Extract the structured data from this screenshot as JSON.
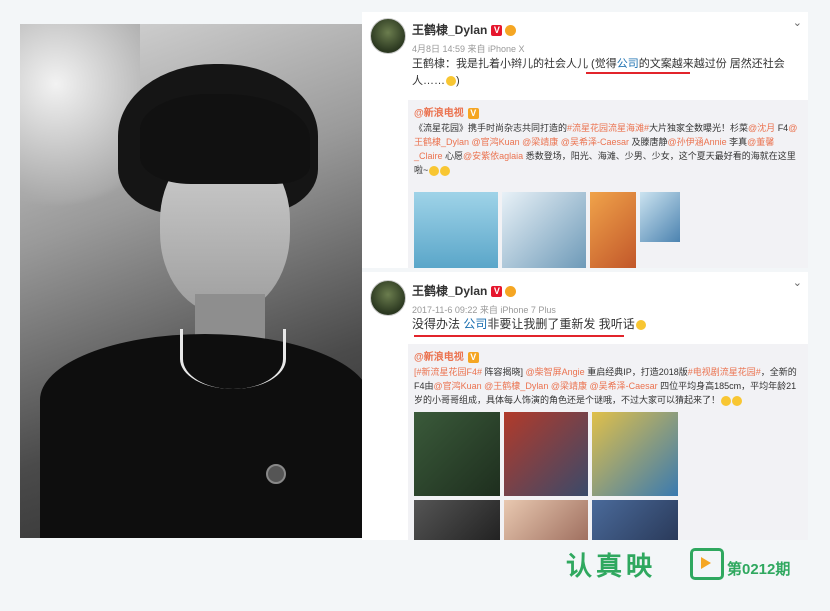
{
  "post1": {
    "username": "王鹤棣_Dylan",
    "meta": "4月8日 14:59 来自 iPhone X",
    "text_a": "王鹤棣：我是扎着小辫儿的社会人儿 (",
    "text_hl1": "觉得",
    "text_hl2": "公司",
    "text_hl3": "的文案越来越过份",
    "text_b": " 居然还社会人……",
    "repost": {
      "who": "@新浪电视",
      "body_a": "《流星花园》携手时尚杂志共同打造的",
      "tag": "#流星花园流星海滩#",
      "body_b": "大片独家全数曝光！杉菜",
      "names1": "@沈月",
      "body_c": " F4",
      "names2": "@王鹤棣_Dylan @官鸿Kuan @梁靖康 @吴希泽-Caesar",
      "body_d": " 及滕唐静",
      "names3": "@孙伊涵Annie",
      "body_e": " 李真",
      "names4": "@董馨_Claire",
      "body_f": " 心愿",
      "names5": "@安紫依aglaia",
      "body_g": " 悉数登场，阳光、海滩、少男、少女，这个夏天最好看的海就在这里啦~"
    }
  },
  "post2": {
    "username": "王鹤棣_Dylan",
    "meta": "2017-11-6 09:22 来自 iPhone 7 Plus",
    "text_a": "没得办法 ",
    "text_hl": "公司",
    "text_b": "非要让我删了重新发 我听话",
    "repost": {
      "who": "@新浪电视",
      "tag": "[#新流星花园F4#",
      "body_a": " 阵容揭晓] ",
      "names1": "@柴智屏Angie",
      "body_b": " 重启经典IP，打造2018版",
      "tag2": "#电视剧流星花园#",
      "body_c": "，全新的F4由",
      "names2": "@官鸿Kuan @王鹤棣_Dylan @梁靖康 @吴希泽-Caesar",
      "body_d": " 四位平均身高185cm，平均年龄21岁的小哥哥组成，具体每人饰演的角色还是个谜哦，不过大家可以猜起来了！"
    }
  },
  "brand": {
    "name": "认真映",
    "issue": "第0212期"
  },
  "colors": {
    "brand_green": "#2fa85f",
    "link_orange": "#eb7350",
    "underline_red": "#e2242b"
  }
}
